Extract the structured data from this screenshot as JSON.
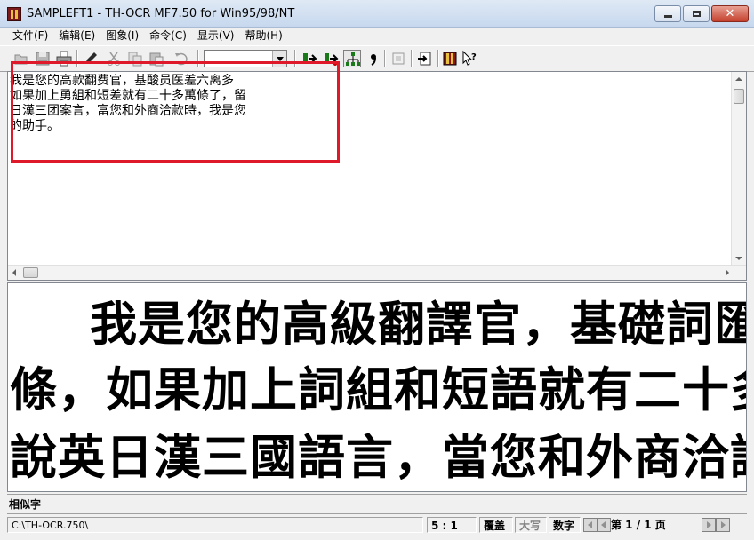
{
  "window": {
    "title": "SAMPLEFT1 - TH-OCR MF7.50 for Win95/98/NT"
  },
  "menu": {
    "items": [
      "文件(F)",
      "编辑(E)",
      "图象(I)",
      "命令(C)",
      "显示(V)",
      "帮助(H)"
    ]
  },
  "toolbar": {
    "combo_value": "",
    "icons": [
      "open-icon",
      "save-icon",
      "print-icon",
      "pen-icon",
      "cut-icon",
      "copy-icon",
      "paste-icon",
      "undo-icon",
      "recognize-icon",
      "recognize-next-icon",
      "tree-icon",
      "comma-icon",
      "frame-icon",
      "export-icon",
      "film-icon",
      "help-cursor-icon"
    ]
  },
  "text_pane": {
    "lines": [
      "我是您的高款翻费官，基酸员医差六离多",
      "如果加上勇組和短差就有二十多萬條了，留",
      "日漢三团案言，富您和外商洽款時，我是您",
      "的助手。"
    ]
  },
  "image_pane": {
    "lines": [
      "我是您的高級翻譯官，基礎詞匯達",
      "條，如果加上詞組和短語就有二十多萬個",
      "說英日漢三國語言，當您和外商洽談時"
    ]
  },
  "candidate": {
    "label": "相似字"
  },
  "status": {
    "path": "C:\\TH-OCR.750\\",
    "ratio": "5 : 1",
    "overwrite": "覆盖",
    "caps": "大写",
    "num": "数字",
    "page": "第 1 / 1 页"
  },
  "colors": {
    "highlight": "#e0192a"
  }
}
